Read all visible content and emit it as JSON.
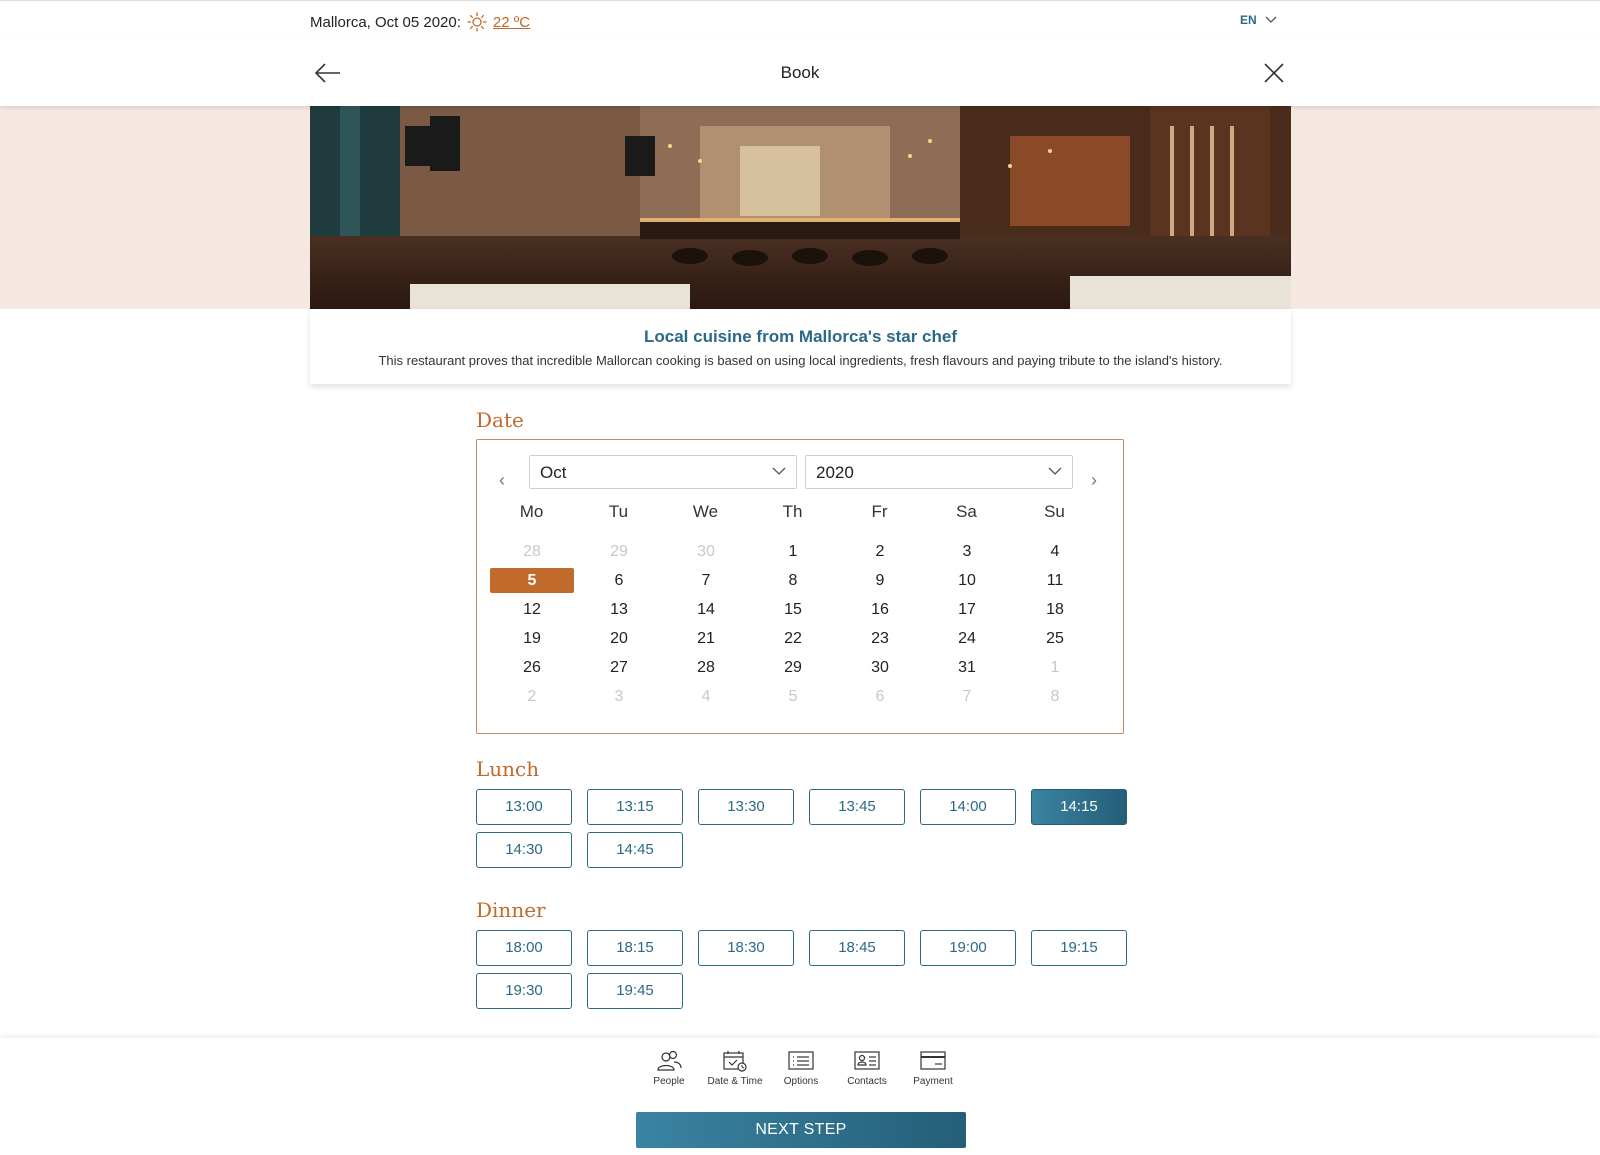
{
  "topbar": {
    "location_date": "Mallorca, Oct 05 2020:",
    "temperature": "22 ºC",
    "language": "EN"
  },
  "header": {
    "title": "Book"
  },
  "intro": {
    "headline": "Local cuisine from Mallorca's star chef",
    "description": "This restaurant proves that incredible Mallorcan cooking is based on using local ingredients, fresh flavours and paying tribute to the island's history."
  },
  "date_section": {
    "title": "Date",
    "month_select": "Oct",
    "year_select": "2020",
    "weekdays": [
      "Mo",
      "Tu",
      "We",
      "Th",
      "Fr",
      "Sa",
      "Su"
    ],
    "weeks": [
      [
        "28",
        "29",
        "30",
        "1",
        "2",
        "3",
        "4"
      ],
      [
        "5",
        "6",
        "7",
        "8",
        "9",
        "10",
        "11"
      ],
      [
        "12",
        "13",
        "14",
        "15",
        "16",
        "17",
        "18"
      ],
      [
        "19",
        "20",
        "21",
        "22",
        "23",
        "24",
        "25"
      ],
      [
        "26",
        "27",
        "28",
        "29",
        "30",
        "31",
        "1"
      ],
      [
        "2",
        "3",
        "4",
        "5",
        "6",
        "7",
        "8"
      ]
    ],
    "selected_day": "5"
  },
  "lunch": {
    "title": "Lunch",
    "slots": [
      "13:00",
      "13:15",
      "13:30",
      "13:45",
      "14:00",
      "14:15",
      "14:30",
      "14:45"
    ],
    "selected": "14:15"
  },
  "dinner": {
    "title": "Dinner",
    "slots": [
      "18:00",
      "18:15",
      "18:30",
      "18:45",
      "19:00",
      "19:15",
      "19:30",
      "19:45"
    ]
  },
  "steps": [
    {
      "label": "People",
      "icon": "people-icon",
      "done": true
    },
    {
      "label": "Date & Time",
      "icon": "calendar-clock-icon",
      "done": true
    },
    {
      "label": "Options",
      "icon": "list-icon",
      "done": false
    },
    {
      "label": "Contacts",
      "icon": "contact-card-icon",
      "done": false
    },
    {
      "label": "Payment",
      "icon": "credit-card-icon",
      "done": false
    }
  ],
  "next_button": "NEXT STEP",
  "colors": {
    "accent_orange": "#c06a2b",
    "accent_teal": "#2b6a86",
    "hero_band": "#f4e8e0"
  }
}
